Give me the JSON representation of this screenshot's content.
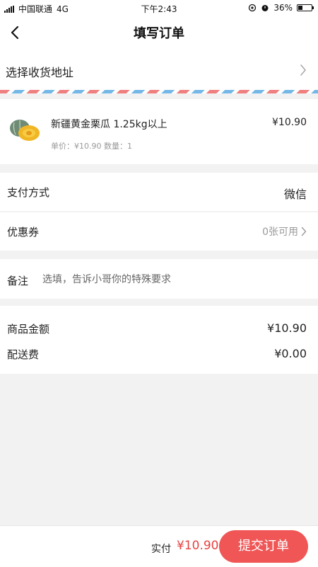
{
  "status_bar": {
    "carrier": "中国联通",
    "network": "4G",
    "time": "下午2:43",
    "battery": "36%",
    "battery_level": 0.36
  },
  "nav": {
    "title": "填写订单",
    "back_icon": "chevron-left-icon"
  },
  "address": {
    "label": "选择收货地址",
    "chevron_icon": "chevron-right-icon"
  },
  "product": {
    "name": "新疆黄金栗瓜 1.25kg以上",
    "price": "¥10.90",
    "detail": "单价：¥10.90 数量：1",
    "thumb_icon": "melon-icon"
  },
  "payment": {
    "label": "支付方式",
    "value": "微信"
  },
  "coupon": {
    "label": "优惠券",
    "value": "0张可用"
  },
  "remark": {
    "label": "备注",
    "placeholder": "选填，告诉小哥你的特殊要求",
    "value": ""
  },
  "summary": {
    "goods_label": "商品金额",
    "goods_value": "¥10.90",
    "delivery_label": "配送费",
    "delivery_value": "¥0.00"
  },
  "footer": {
    "paid_label": "实付",
    "paid_amount": "¥10.90",
    "submit_label": "提交订单"
  },
  "colors": {
    "accent": "#f05656",
    "price_red": "#e94141",
    "background": "#f2f2f2"
  }
}
